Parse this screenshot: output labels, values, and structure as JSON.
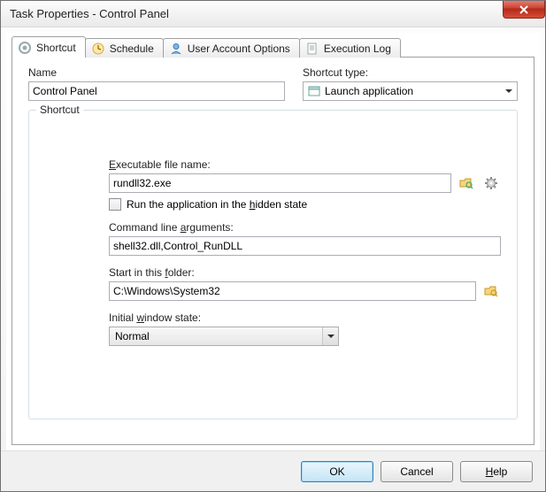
{
  "window": {
    "title": "Task Properties - Control Panel"
  },
  "tabs": [
    {
      "label": "Shortcut"
    },
    {
      "label": "Schedule"
    },
    {
      "label": "User Account Options"
    },
    {
      "label": "Execution Log"
    }
  ],
  "name": {
    "label": "Name",
    "value": "Control Panel"
  },
  "shortcutType": {
    "label": "Shortcut type:",
    "selected": "Launch application"
  },
  "group": {
    "title": "Shortcut"
  },
  "exe": {
    "label_pre": "",
    "label_u": "E",
    "label_post": "xecutable file name:",
    "value": "rundll32.exe"
  },
  "hidden": {
    "label_pre": "Run the application in the ",
    "label_u": "h",
    "label_post": "idden state"
  },
  "args": {
    "label_pre": "Command line ",
    "label_u": "a",
    "label_post": "rguments:",
    "value": "shell32.dll,Control_RunDLL"
  },
  "startin": {
    "label_pre": "Start in this ",
    "label_u": "f",
    "label_post": "older:",
    "value": "C:\\Windows\\System32"
  },
  "windowState": {
    "label_pre": "Initial ",
    "label_u": "w",
    "label_post": "indow state:",
    "value": "Normal"
  },
  "buttons": {
    "ok": "OK",
    "cancel": "Cancel",
    "help_u": "H",
    "help_post": "elp"
  }
}
